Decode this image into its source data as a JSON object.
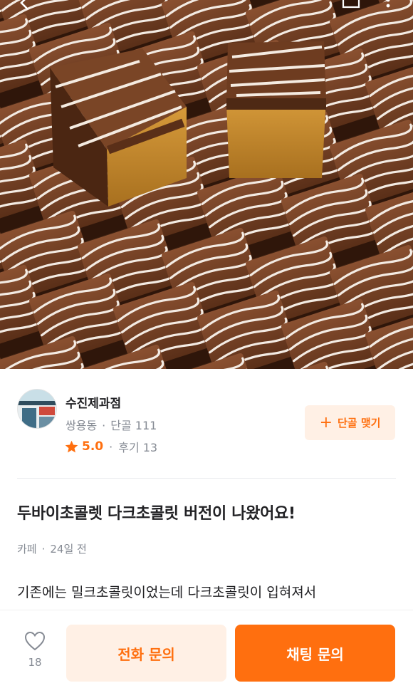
{
  "seller": {
    "name": "수진제과점",
    "location": "쌍용동",
    "regulars_label": "단골 111",
    "rating": "5.0",
    "reviews_label": "후기 13",
    "follow_label": "단골 맺기"
  },
  "post": {
    "title": "두바이초콜렛 다크초콜릿 버전이 나왔어요!",
    "category": "카페",
    "time_ago": "24일 전",
    "body_preview": "기존에는 밀크초콜릿이었는데 다크초콜릿이 입혀져서"
  },
  "actions": {
    "like_count": "18",
    "call_label": "전화 문의",
    "chat_label": "채팅 문의"
  },
  "colors": {
    "accent": "#ff6f0f",
    "accent_light": "#fff0e5",
    "muted_text": "#868b94"
  },
  "icons": {
    "back": "arrow-left-icon",
    "share": "share-icon",
    "more": "more-icon",
    "star": "star-icon",
    "plus": "plus-icon",
    "heart": "heart-icon"
  }
}
